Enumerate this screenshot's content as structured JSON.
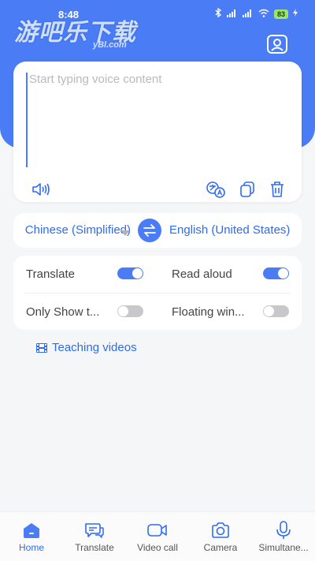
{
  "status_bar": {
    "time": "8:48",
    "battery": "83"
  },
  "watermark": {
    "main": "游吧乐下载",
    "sub": "yBl.com"
  },
  "colors": {
    "accent": "#4a7cf6",
    "link": "#2f6bf0",
    "toggle_off": "#c8c8cc"
  },
  "voice_card": {
    "placeholder": "Start typing voice content",
    "tools": [
      "speaker-icon",
      "translate-icon",
      "copy-icon",
      "trash-icon"
    ]
  },
  "languages": {
    "source": "Chinese (Simplified)",
    "target": "English (United States)"
  },
  "settings": {
    "translate": {
      "label": "Translate",
      "on": true
    },
    "read_aloud": {
      "label": "Read aloud",
      "on": true
    },
    "only_show": {
      "label": "Only Show t...",
      "on": false
    },
    "floating": {
      "label": "Floating win...",
      "on": false
    }
  },
  "teaching": {
    "label": "Teaching videos"
  },
  "nav": {
    "items": [
      {
        "label": "Home",
        "icon": "home-icon",
        "active": true
      },
      {
        "label": "Translate",
        "icon": "chat-translate-icon",
        "active": false
      },
      {
        "label": "Video call",
        "icon": "video-camera-icon",
        "active": false
      },
      {
        "label": "Camera",
        "icon": "camera-icon",
        "active": false
      },
      {
        "label": "Simultane...",
        "icon": "microphone-icon",
        "active": false
      }
    ]
  }
}
